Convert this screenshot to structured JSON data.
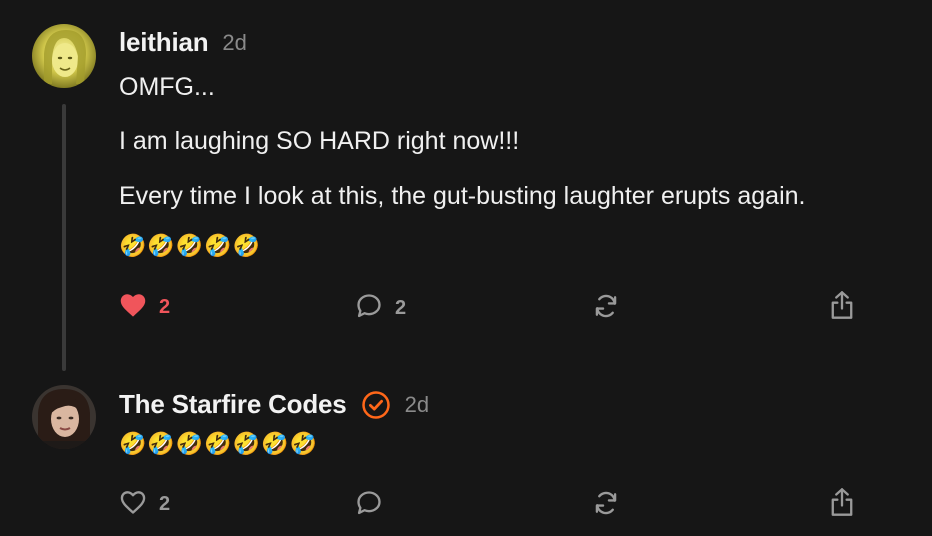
{
  "comments": [
    {
      "username": "leithian",
      "time": "2d",
      "lines": [
        "OMFG...",
        "I am laughing SO HARD right now!!!",
        "Every time I look at this, the gut-busting laughter erupts again."
      ],
      "emojis": [
        "🤣",
        "🤣",
        "🤣",
        "🤣",
        "🤣"
      ],
      "like_count": "2",
      "liked": true,
      "comment_count": "2"
    },
    {
      "username": "The Starfire Codes",
      "verified": true,
      "time": "2d",
      "emojis": [
        "🤣",
        "🤣",
        "🤣",
        "🤣",
        "🤣",
        "🤣",
        "🤣"
      ],
      "like_count": "2",
      "liked": false
    }
  ],
  "icons": {
    "like": "heart-icon",
    "comment": "comment-bubble-icon",
    "restack": "restack-icon",
    "share": "share-icon",
    "verified": "verified-check-icon"
  },
  "colors": {
    "background": "#161616",
    "like_active": "#f0555b",
    "verified": "#ff6719",
    "muted": "#9a9a9a"
  }
}
